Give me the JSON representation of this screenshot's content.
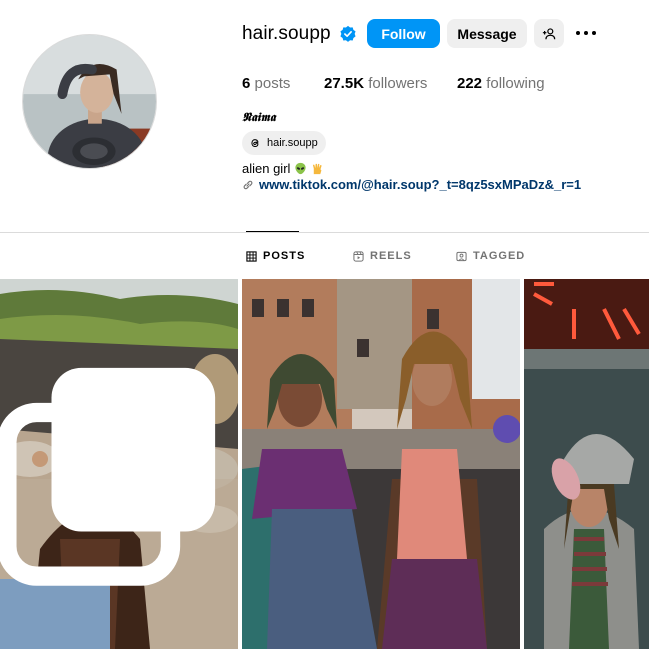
{
  "profile": {
    "username": "hair.soupp",
    "verified": true,
    "full_name": "𝕹𝖆𝖎𝖒𝖆",
    "threads_handle": "hair.soupp",
    "bio": "alien girl",
    "link": "www.tiktok.com/@hair.soup?_t=8qz5sxMPaDz&_r=1"
  },
  "actions": {
    "follow_label": "Follow",
    "message_label": "Message"
  },
  "stats": {
    "posts_count": "6",
    "posts_label": "posts",
    "followers_count": "27.5K",
    "followers_label": "followers",
    "following_count": "222",
    "following_label": "following"
  },
  "tabs": {
    "posts": "POSTS",
    "reels": "REELS",
    "tagged": "TAGGED"
  },
  "icons": {
    "verified": "verified-badge-icon",
    "add_user": "add-user-icon",
    "more": "more-options-icon",
    "threads": "threads-icon",
    "link": "link-icon",
    "posts_tab": "grid-icon",
    "reels_tab": "reels-icon",
    "tagged_tab": "tagged-icon",
    "carousel": "carousel-icon"
  },
  "colors": {
    "accent": "#0095f6",
    "button_bg": "#efefef",
    "link": "#00376b",
    "muted": "#737373",
    "divider": "#dbdbdb"
  }
}
